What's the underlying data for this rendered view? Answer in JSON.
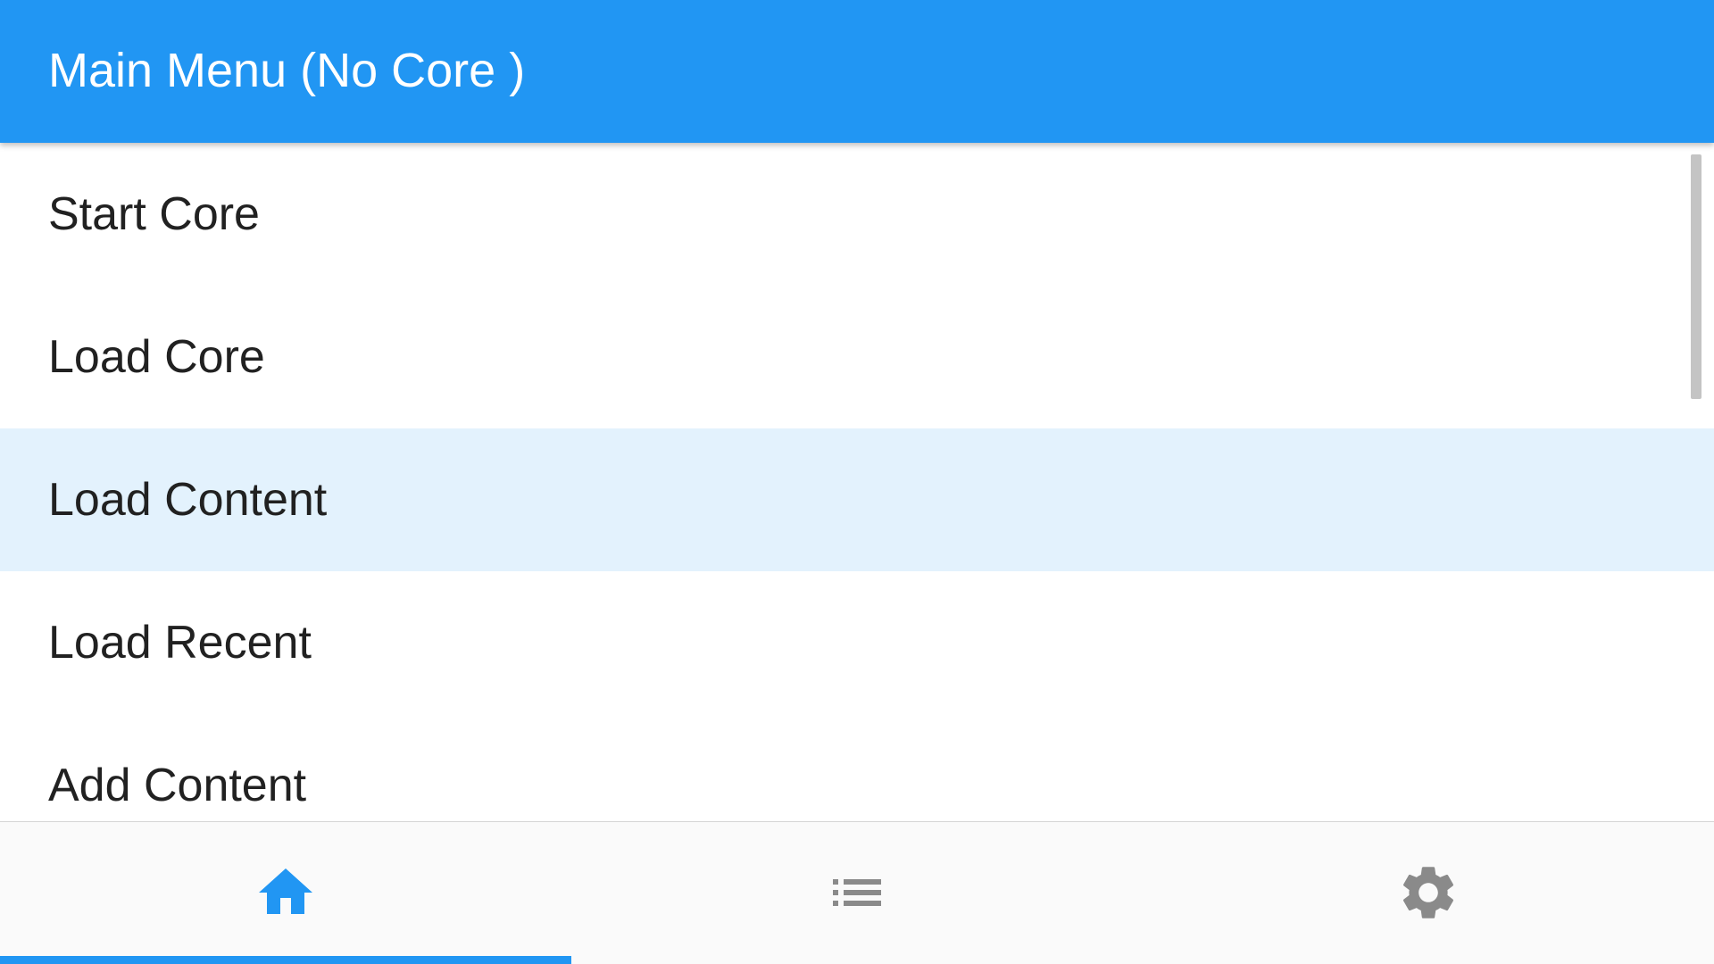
{
  "header": {
    "title": "Main Menu (No Core )"
  },
  "menu": {
    "items": [
      {
        "label": "Start Core"
      },
      {
        "label": "Load Core"
      },
      {
        "label": "Load Content"
      },
      {
        "label": "Load Recent"
      },
      {
        "label": "Add Content"
      }
    ],
    "selected_index": 2
  },
  "bottom_nav": {
    "tabs": [
      {
        "icon": "home-icon",
        "active": true
      },
      {
        "icon": "list-icon",
        "active": false
      },
      {
        "icon": "gear-icon",
        "active": false
      }
    ]
  },
  "colors": {
    "accent": "#2196f3",
    "selected_row": "#e3f2fd",
    "text": "#212121",
    "inactive_icon": "#8a8a8a"
  }
}
